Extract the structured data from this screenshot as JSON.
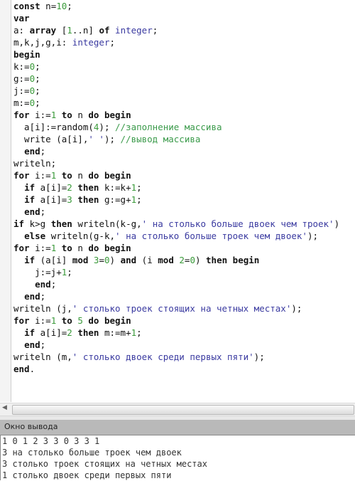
{
  "editor": {
    "lines": [
      [
        [
          "kw",
          "const"
        ],
        [
          "plain",
          " n="
        ],
        [
          "num",
          "10"
        ],
        [
          "plain",
          ";"
        ]
      ],
      [
        [
          "kw",
          "var"
        ]
      ],
      [
        [
          "plain",
          "a: "
        ],
        [
          "kw",
          "array"
        ],
        [
          "plain",
          " ["
        ],
        [
          "num",
          "1"
        ],
        [
          "plain",
          "..n] "
        ],
        [
          "kw",
          "of"
        ],
        [
          "plain",
          " "
        ],
        [
          "type",
          "integer"
        ],
        [
          "plain",
          ";"
        ]
      ],
      [
        [
          "plain",
          "m,k,j,g,i: "
        ],
        [
          "type",
          "integer"
        ],
        [
          "plain",
          ";"
        ]
      ],
      [
        [
          "kw",
          "begin"
        ]
      ],
      [
        [
          "plain",
          "k:="
        ],
        [
          "num",
          "0"
        ],
        [
          "plain",
          ";"
        ]
      ],
      [
        [
          "plain",
          "g:="
        ],
        [
          "num",
          "0"
        ],
        [
          "plain",
          ";"
        ]
      ],
      [
        [
          "plain",
          "j:="
        ],
        [
          "num",
          "0"
        ],
        [
          "plain",
          ";"
        ]
      ],
      [
        [
          "plain",
          "m:="
        ],
        [
          "num",
          "0"
        ],
        [
          "plain",
          ";"
        ]
      ],
      [
        [
          "kw",
          "for"
        ],
        [
          "plain",
          " i:="
        ],
        [
          "num",
          "1"
        ],
        [
          "plain",
          " "
        ],
        [
          "kw",
          "to"
        ],
        [
          "plain",
          " n "
        ],
        [
          "kw",
          "do"
        ],
        [
          "plain",
          " "
        ],
        [
          "kw",
          "begin"
        ]
      ],
      [
        [
          "plain",
          "  a[i]:=random("
        ],
        [
          "num",
          "4"
        ],
        [
          "plain",
          "); "
        ],
        [
          "com",
          "//заполнение массива"
        ]
      ],
      [
        [
          "plain",
          "  write (a[i],"
        ],
        [
          "str",
          "' '"
        ],
        [
          "plain",
          "); "
        ],
        [
          "com",
          "//вывод массива"
        ]
      ],
      [
        [
          "plain",
          "  "
        ],
        [
          "kw",
          "end"
        ],
        [
          "plain",
          ";"
        ]
      ],
      [
        [
          "plain",
          "writeln;"
        ]
      ],
      [
        [
          "kw",
          "for"
        ],
        [
          "plain",
          " i:="
        ],
        [
          "num",
          "1"
        ],
        [
          "plain",
          " "
        ],
        [
          "kw",
          "to"
        ],
        [
          "plain",
          " n "
        ],
        [
          "kw",
          "do"
        ],
        [
          "plain",
          " "
        ],
        [
          "kw",
          "begin"
        ]
      ],
      [
        [
          "plain",
          "  "
        ],
        [
          "kw",
          "if"
        ],
        [
          "plain",
          " a[i]="
        ],
        [
          "num",
          "2"
        ],
        [
          "plain",
          " "
        ],
        [
          "kw",
          "then"
        ],
        [
          "plain",
          " k:=k+"
        ],
        [
          "num",
          "1"
        ],
        [
          "plain",
          ";"
        ]
      ],
      [
        [
          "plain",
          "  "
        ],
        [
          "kw",
          "if"
        ],
        [
          "plain",
          " a[i]="
        ],
        [
          "num",
          "3"
        ],
        [
          "plain",
          " "
        ],
        [
          "kw",
          "then"
        ],
        [
          "plain",
          " g:=g+"
        ],
        [
          "num",
          "1"
        ],
        [
          "plain",
          ";"
        ]
      ],
      [
        [
          "plain",
          "  "
        ],
        [
          "kw",
          "end"
        ],
        [
          "plain",
          ";"
        ]
      ],
      [
        [
          "kw",
          "if"
        ],
        [
          "plain",
          " k>g "
        ],
        [
          "kw",
          "then"
        ],
        [
          "plain",
          " writeln(k-g,"
        ],
        [
          "str",
          "' на столько больше двоек чем троек'"
        ],
        [
          "plain",
          ")"
        ]
      ],
      [
        [
          "plain",
          "  "
        ],
        [
          "kw",
          "else"
        ],
        [
          "plain",
          " writeln(g-k,"
        ],
        [
          "str",
          "' на столько больше троек чем двоек'"
        ],
        [
          "plain",
          ");"
        ]
      ],
      [
        [
          "kw",
          "for"
        ],
        [
          "plain",
          " i:="
        ],
        [
          "num",
          "1"
        ],
        [
          "plain",
          " "
        ],
        [
          "kw",
          "to"
        ],
        [
          "plain",
          " n "
        ],
        [
          "kw",
          "do"
        ],
        [
          "plain",
          " "
        ],
        [
          "kw",
          "begin"
        ]
      ],
      [
        [
          "plain",
          "  "
        ],
        [
          "kw",
          "if"
        ],
        [
          "plain",
          " (a[i] "
        ],
        [
          "kw",
          "mod"
        ],
        [
          "plain",
          " "
        ],
        [
          "num",
          "3"
        ],
        [
          "plain",
          "="
        ],
        [
          "num",
          "0"
        ],
        [
          "plain",
          ") "
        ],
        [
          "kw",
          "and"
        ],
        [
          "plain",
          " (i "
        ],
        [
          "kw",
          "mod"
        ],
        [
          "plain",
          " "
        ],
        [
          "num",
          "2"
        ],
        [
          "plain",
          "="
        ],
        [
          "num",
          "0"
        ],
        [
          "plain",
          ") "
        ],
        [
          "kw",
          "then"
        ],
        [
          "plain",
          " "
        ],
        [
          "kw",
          "begin"
        ]
      ],
      [
        [
          "plain",
          "    j:=j+"
        ],
        [
          "num",
          "1"
        ],
        [
          "plain",
          ";"
        ]
      ],
      [
        [
          "plain",
          "    "
        ],
        [
          "kw",
          "end"
        ],
        [
          "plain",
          ";"
        ]
      ],
      [
        [
          "plain",
          "  "
        ],
        [
          "kw",
          "end"
        ],
        [
          "plain",
          ";"
        ]
      ],
      [
        [
          "plain",
          "writeln (j,"
        ],
        [
          "str",
          "' столько троек стоящих на четных местах'"
        ],
        [
          "plain",
          ");"
        ]
      ],
      [
        [
          "kw",
          "for"
        ],
        [
          "plain",
          " i:="
        ],
        [
          "num",
          "1"
        ],
        [
          "plain",
          " "
        ],
        [
          "kw",
          "to"
        ],
        [
          "plain",
          " "
        ],
        [
          "num",
          "5"
        ],
        [
          "plain",
          " "
        ],
        [
          "kw",
          "do"
        ],
        [
          "plain",
          " "
        ],
        [
          "kw",
          "begin"
        ]
      ],
      [
        [
          "plain",
          "  "
        ],
        [
          "kw",
          "if"
        ],
        [
          "plain",
          " a[i]="
        ],
        [
          "num",
          "2"
        ],
        [
          "plain",
          " "
        ],
        [
          "kw",
          "then"
        ],
        [
          "plain",
          " m:=m+"
        ],
        [
          "num",
          "1"
        ],
        [
          "plain",
          ";"
        ]
      ],
      [
        [
          "plain",
          "  "
        ],
        [
          "kw",
          "end"
        ],
        [
          "plain",
          ";"
        ]
      ],
      [
        [
          "plain",
          "writeln (m,"
        ],
        [
          "str",
          "' столько двоек среди первых пяти'"
        ],
        [
          "plain",
          ");"
        ]
      ],
      [
        [
          "kw",
          "end"
        ],
        [
          "plain",
          "."
        ]
      ]
    ]
  },
  "output_panel": {
    "title": "Окно вывода",
    "lines": [
      "1 0 1 2 3 3 0 3 3 1",
      "3 на столько больше троек чем двоек",
      "3 столько троек стоящих на четных местах",
      "1 столько двоек среди первых пяти"
    ]
  },
  "colors": {
    "keyword": "#111111",
    "number": "#3a9a3a",
    "type": "#3a3aa0",
    "string": "#3a3aa0",
    "comment": "#3a9a4a"
  }
}
